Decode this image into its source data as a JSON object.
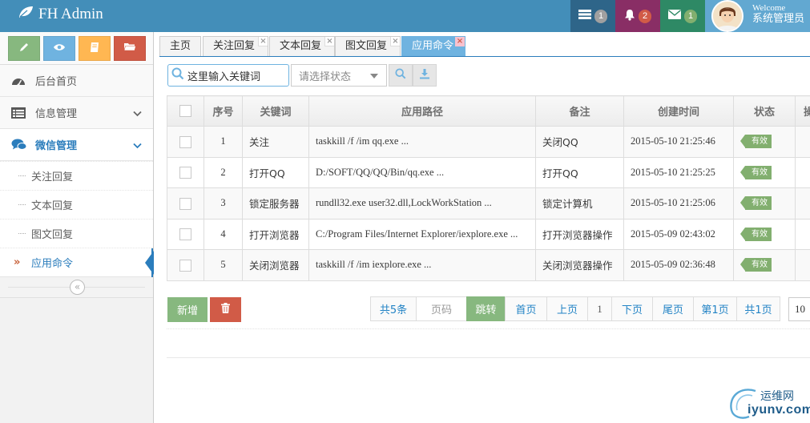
{
  "app": {
    "title": "FH Admin"
  },
  "navbar": {
    "tasks_count": "1",
    "notifications_count": "2",
    "messages_count": "1",
    "welcome": "Welcome",
    "user_name": "系统管理员"
  },
  "sidebar": {
    "menu": [
      {
        "label": "后台首页",
        "icon": "dashboard-icon"
      },
      {
        "label": "信息管理",
        "icon": "list-icon"
      },
      {
        "label": "微信管理",
        "icon": "chat-icon"
      }
    ],
    "submenu": [
      {
        "label": "关注回复"
      },
      {
        "label": "文本回复"
      },
      {
        "label": "图文回复"
      },
      {
        "label": "应用命令",
        "active": true
      }
    ],
    "collapse_glyph": "«"
  },
  "tabs": [
    {
      "label": "主页"
    },
    {
      "label": "关注回复"
    },
    {
      "label": "文本回复"
    },
    {
      "label": "图文回复"
    },
    {
      "label": "应用命令",
      "active": true
    }
  ],
  "toolbar": {
    "search_placeholder": "这里输入关键词",
    "status_placeholder": "请选择状态"
  },
  "table": {
    "headers": [
      "序号",
      "关键词",
      "应用路径",
      "备注",
      "创建时间",
      "状态",
      "操"
    ],
    "rows": [
      {
        "no": "1",
        "keyword": "关注",
        "path": "taskkill /f /im qq.exe ...",
        "remark": "关闭QQ",
        "created": "2015-05-10 21:25:46",
        "status": "有效"
      },
      {
        "no": "2",
        "keyword": "打开QQ",
        "path": "D:/SOFT/QQ/QQ/Bin/qq.exe ...",
        "remark": "打开QQ",
        "created": "2015-05-10 21:25:25",
        "status": "有效"
      },
      {
        "no": "3",
        "keyword": "锁定服务器",
        "path": "rundll32.exe user32.dll,LockWorkStation ...",
        "remark": "锁定计算机",
        "created": "2015-05-10 21:25:06",
        "status": "有效"
      },
      {
        "no": "4",
        "keyword": "打开浏览器",
        "path": "C:/Program Files/Internet Explorer/iexplore.exe ...",
        "remark": "打开浏览器操作",
        "created": "2015-05-09 02:43:02",
        "status": "有效"
      },
      {
        "no": "5",
        "keyword": "关闭浏览器",
        "path": "taskkill /f /im iexplore.exe ...",
        "remark": "关闭浏览器操作",
        "created": "2015-05-09 02:36:48",
        "status": "有效"
      }
    ]
  },
  "actions": {
    "add_label": "新增"
  },
  "pager": {
    "total": "共5条",
    "page_input_placeholder": "页码",
    "go": "跳转",
    "first": "首页",
    "prev": "上页",
    "current": "1",
    "next": "下页",
    "last": "尾页",
    "page_of": "第1页",
    "total_pages": "共1页",
    "page_size": "10"
  },
  "watermark": {
    "top": "运维网",
    "bottom": "iyunv.com"
  },
  "colors": {
    "navbar": "#438eb9",
    "accent": "#2b7dbc",
    "success": "#87b87f",
    "danger": "#d15b47",
    "warning": "#ffb752",
    "info": "#6fb3e0"
  }
}
